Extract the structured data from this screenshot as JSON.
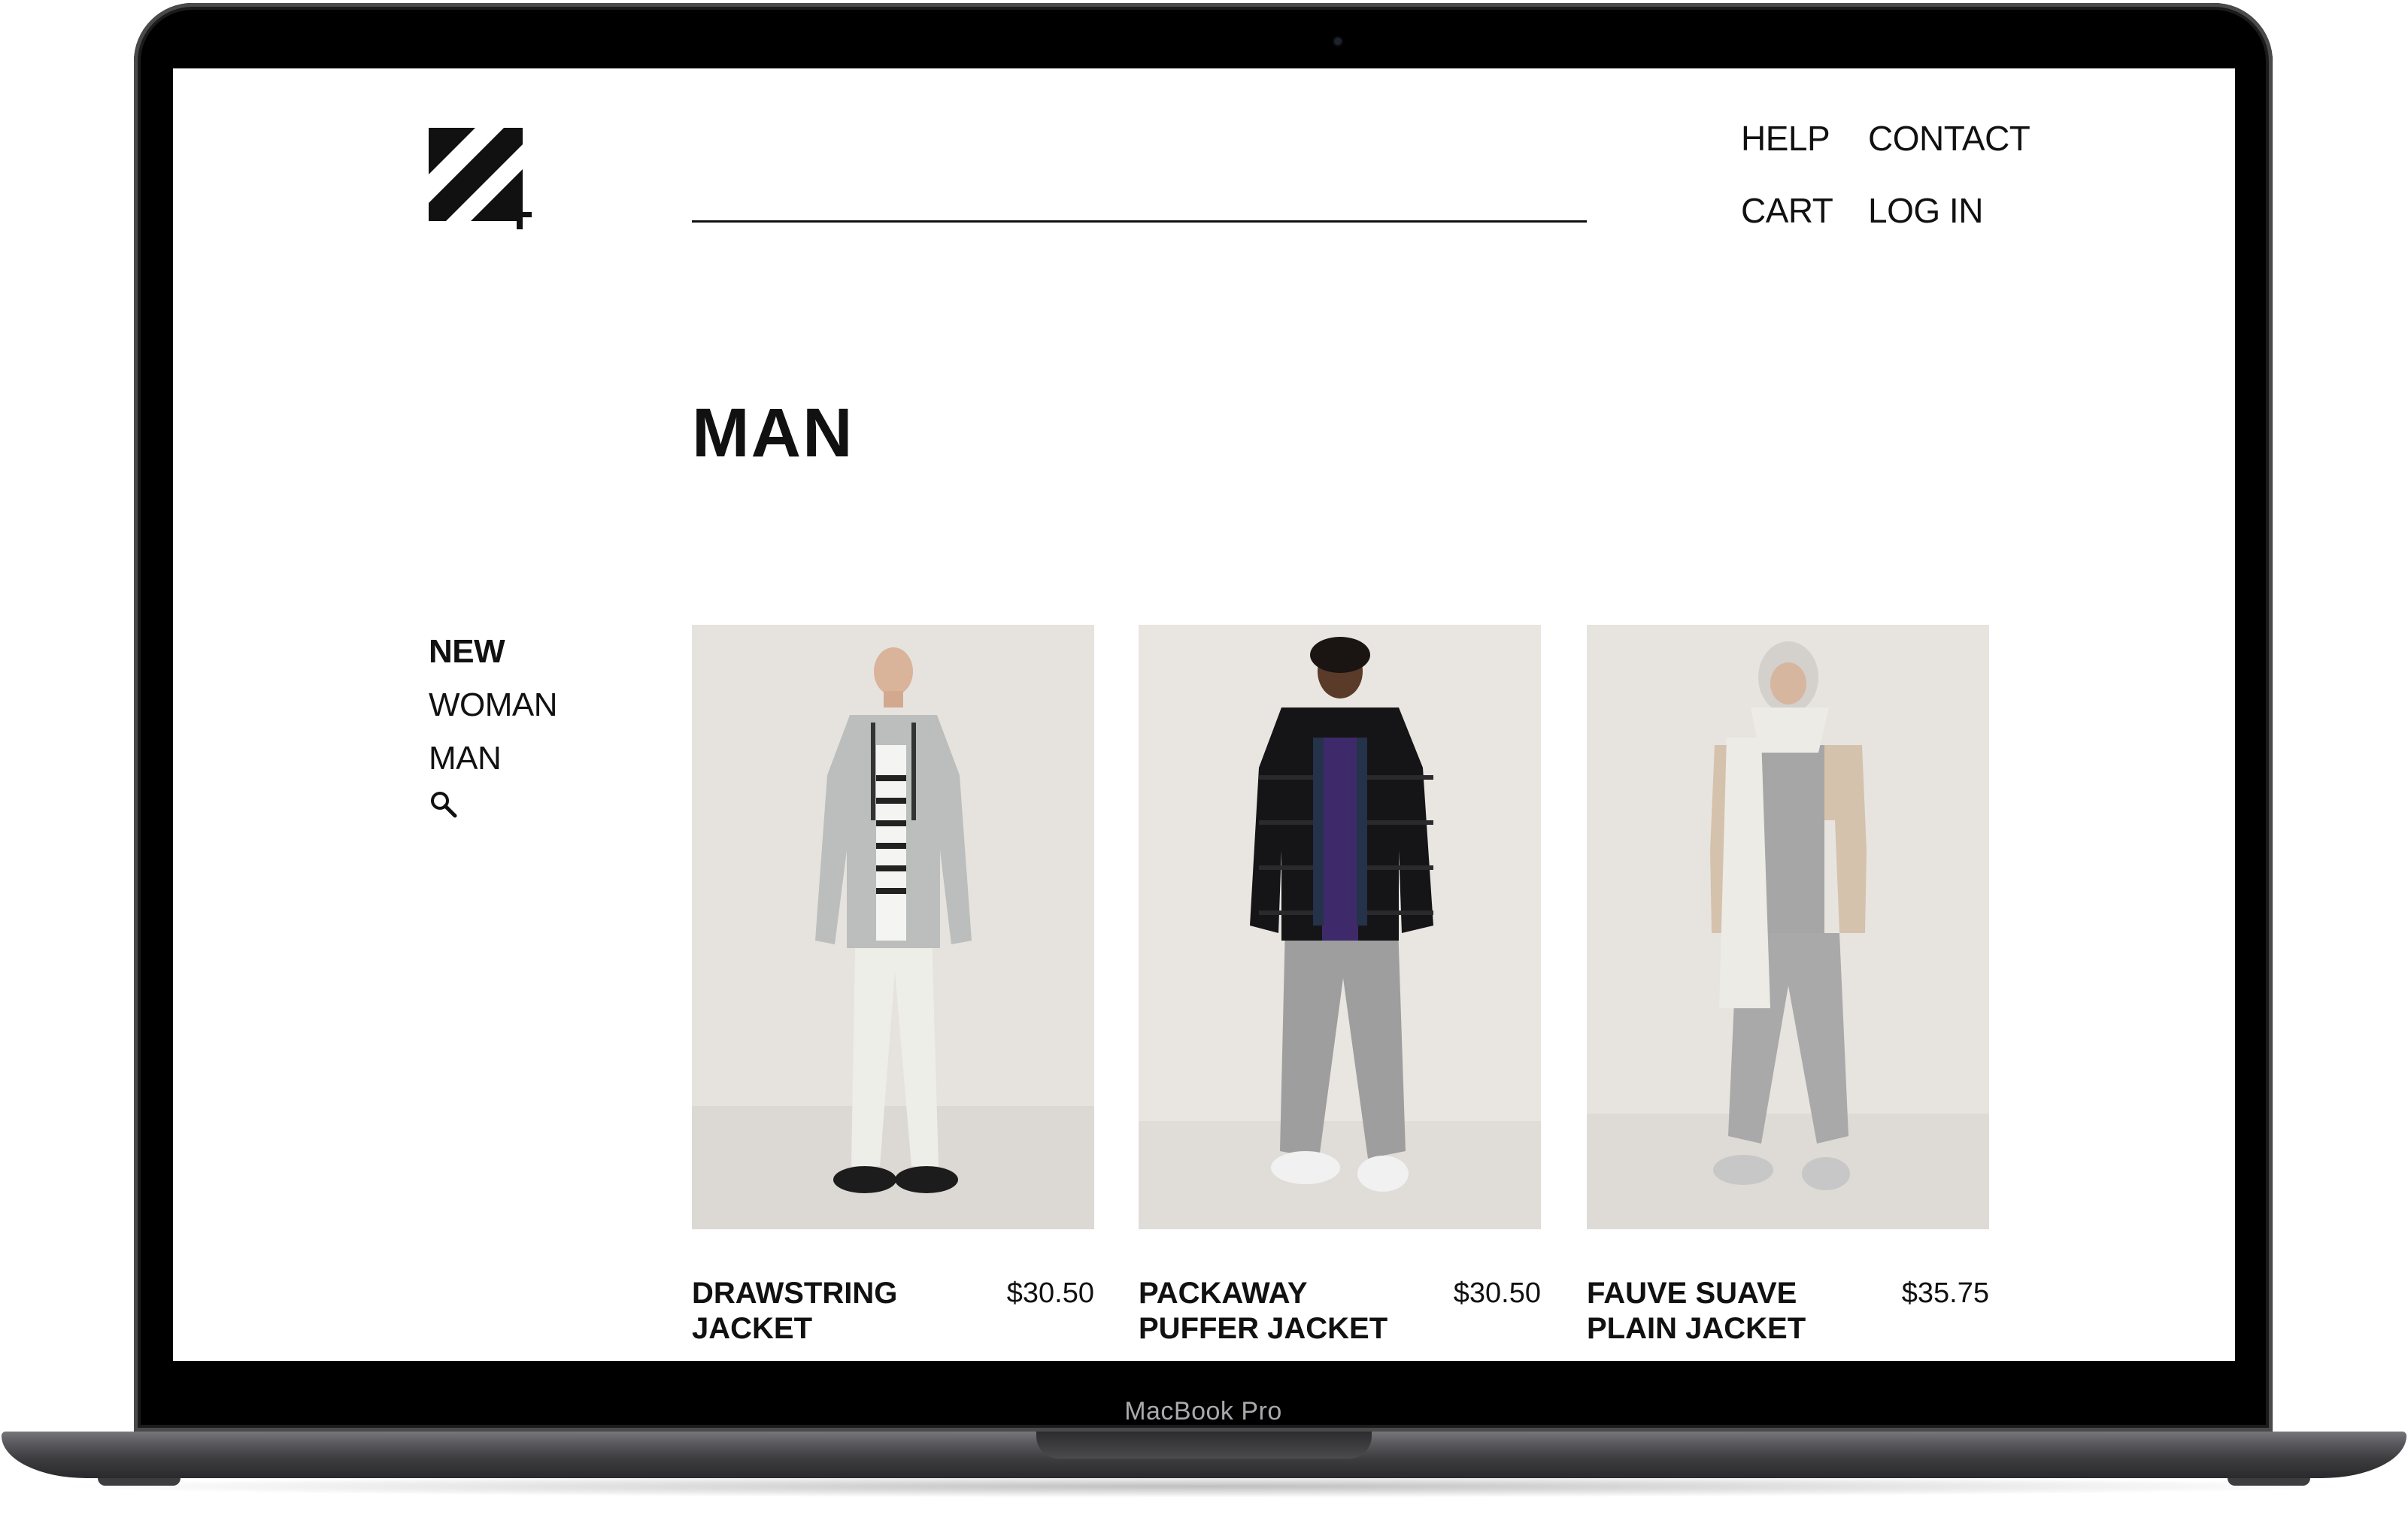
{
  "device": {
    "label": "MacBook Pro"
  },
  "header": {
    "logo_alt": "Z4 logo",
    "nav": {
      "help": "HELP",
      "contact": "CONTACT",
      "cart": "CART",
      "login": "LOG IN"
    }
  },
  "page": {
    "title": "MAN"
  },
  "sidebar": {
    "items": [
      {
        "label": "NEW",
        "active": true
      },
      {
        "label": "WOMAN",
        "active": false
      },
      {
        "label": "MAN",
        "active": false
      }
    ],
    "search_icon": "search-icon"
  },
  "products": [
    {
      "name": "DRAWSTRING JACKET",
      "price": "$30.50",
      "colors": {
        "bg": "#e6e3df",
        "jacket": "#bcbebd",
        "pants": "#eeeee8",
        "shoes": "#1c1c1c"
      }
    },
    {
      "name": "PACKAWAY PUFFER JACKET",
      "price": "$30.50",
      "colors": {
        "bg": "#e9e6e2",
        "jacket": "#151517",
        "pants": "#9e9e9e",
        "shoes": "#f1f1f1"
      }
    },
    {
      "name": "FAUVE SUAVE PLAIN JACKET",
      "price": "$35.75",
      "colors": {
        "bg": "#e7e4e0",
        "jacket": "#d4c2ad",
        "pants": "#a9a9a9",
        "shoes": "#c7c7c7"
      }
    }
  ],
  "colors": {
    "text": "#111111",
    "screen_bg": "#ffffff",
    "bezel": "#000000"
  }
}
